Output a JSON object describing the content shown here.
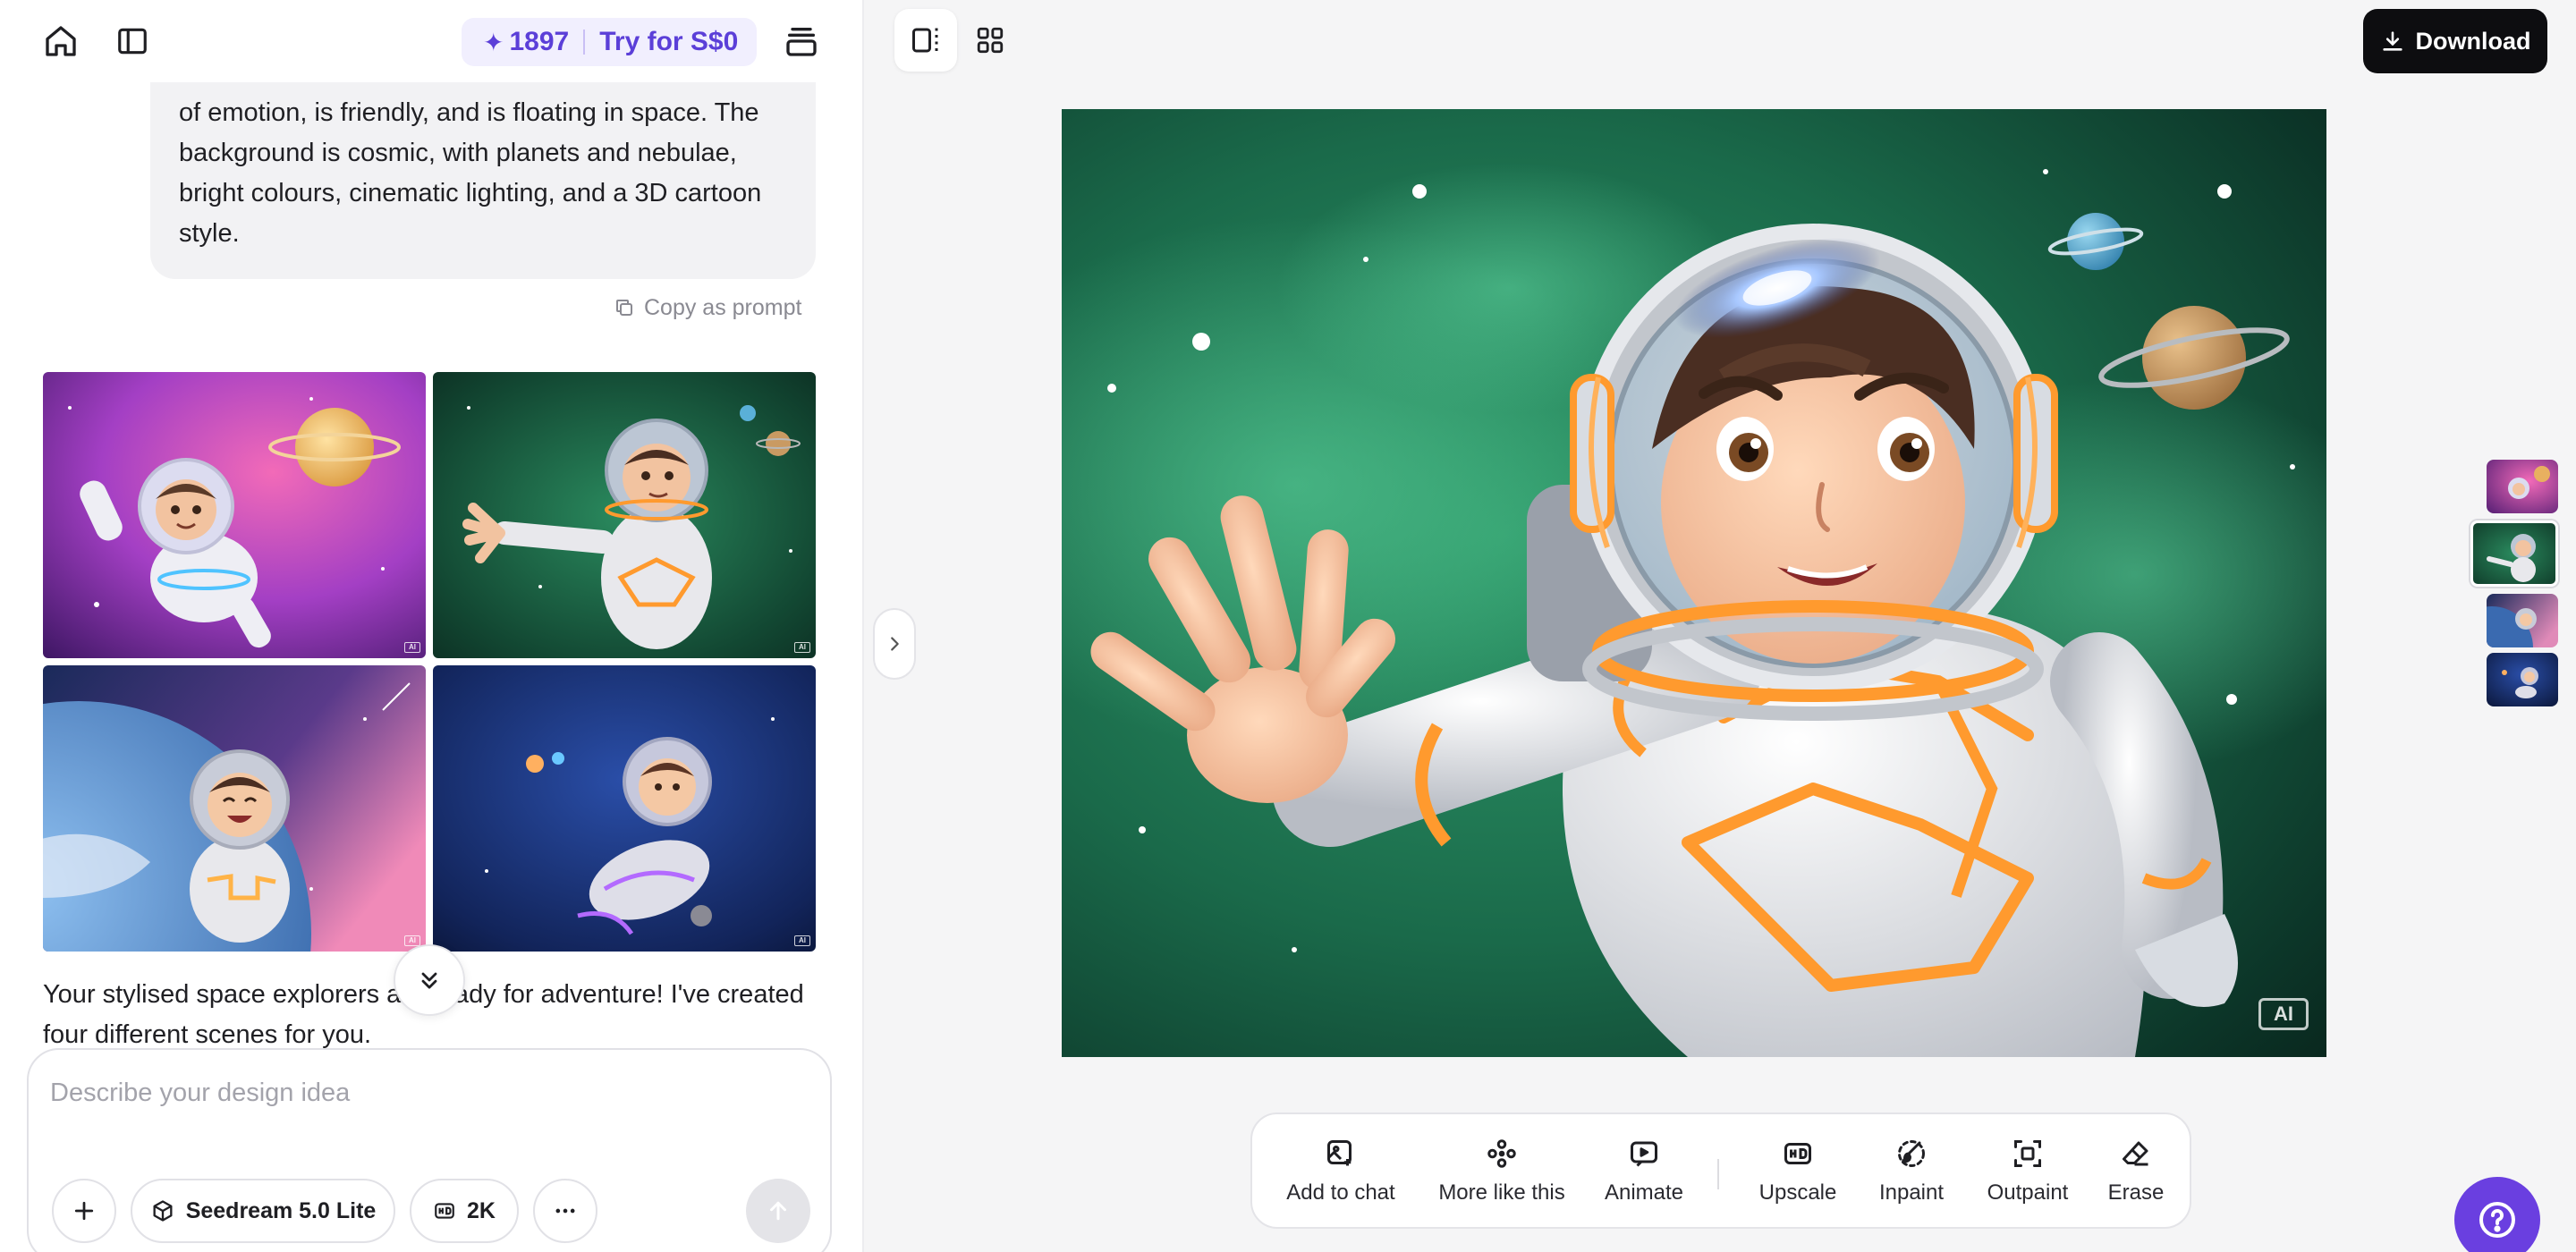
{
  "header": {
    "home_icon": "home-icon",
    "sidebar_icon": "sidebar-toggle-icon",
    "credits": "1897",
    "trial_label": "Try for S$0",
    "history_icon": "stack-icon"
  },
  "conversation": {
    "prompt_text": "of emotion, is friendly, and is floating in space. The background is cosmic, with planets and nebulae, bright colours, cinematic lighting, and a 3D cartoon style.",
    "copy_label": "Copy as prompt",
    "thumbnail_badge": "AI",
    "reply_text": "Your stylised space explorers are ready for adventure! I've created four different scenes for you."
  },
  "composer": {
    "placeholder": "Describe your design idea",
    "model_label": "Seedream 5.0 Lite",
    "resolution_label": "2K"
  },
  "viewer": {
    "download_label": "Download",
    "ai_badge": "AI"
  },
  "toolbar": {
    "add_to_chat": "Add to chat",
    "more_like_this": "More like this",
    "animate": "Animate",
    "upscale": "Upscale",
    "inpaint": "Inpaint",
    "outpaint": "Outpaint",
    "erase": "Erase"
  },
  "colors": {
    "accent": "#6a3fe0",
    "credits_text": "#5b3fd8",
    "credits_bg": "#f1effe",
    "download_bg": "#0d0d10"
  }
}
